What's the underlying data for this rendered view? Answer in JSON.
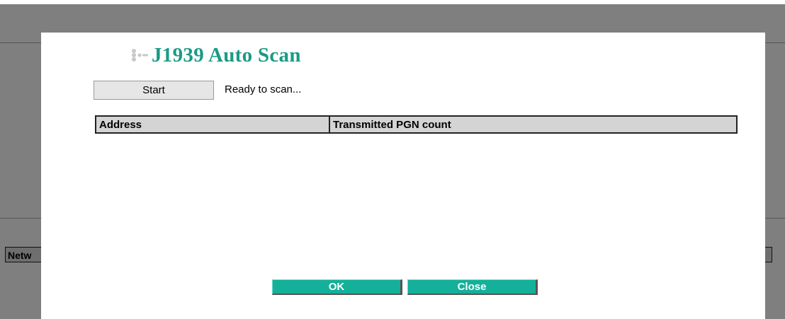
{
  "background": {
    "network_tab_label": "Netw"
  },
  "dialog": {
    "title": "J1939 Auto Scan",
    "title_icon": "dots-bullet-icon",
    "start_label": "Start",
    "status_text": "Ready to scan...",
    "table": {
      "columns": [
        "Address",
        "Transmitted PGN count"
      ],
      "rows": []
    },
    "ok_label": "OK",
    "close_label": "Close"
  },
  "colors": {
    "accent": "#1a9a85",
    "button_teal": "#14b09a",
    "overlay": "rgba(0,0,0,0.5)"
  }
}
